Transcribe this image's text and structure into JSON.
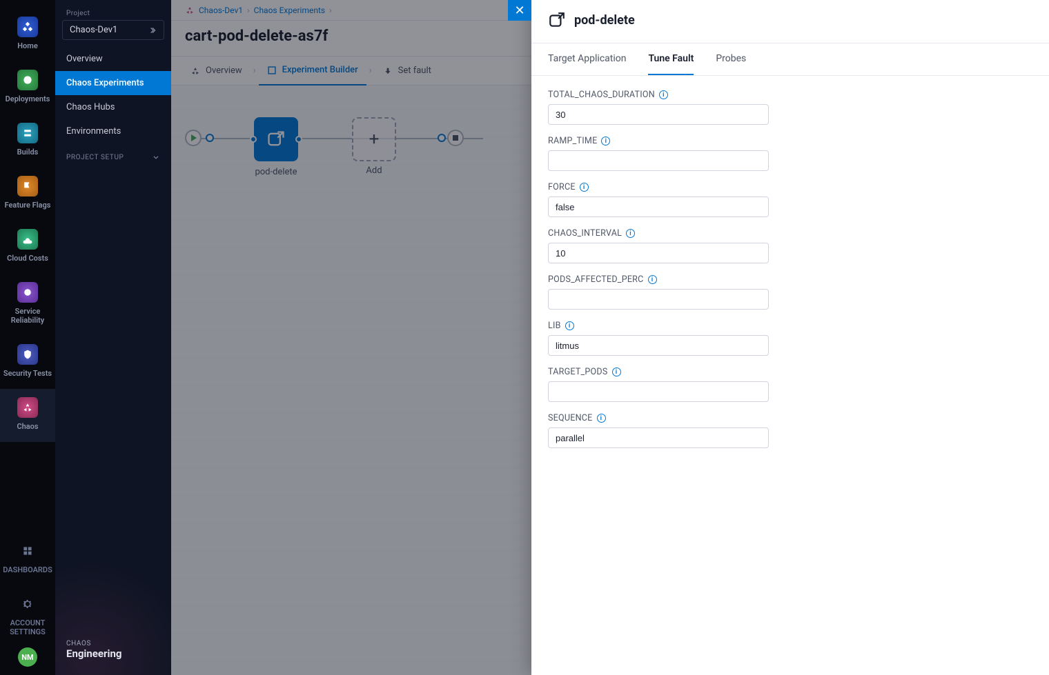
{
  "leftrail": {
    "items": [
      {
        "key": "home",
        "label": "Home"
      },
      {
        "key": "deployments",
        "label": "Deployments"
      },
      {
        "key": "builds",
        "label": "Builds"
      },
      {
        "key": "featureflags",
        "label": "Feature Flags"
      },
      {
        "key": "cloudcosts",
        "label": "Cloud Costs"
      },
      {
        "key": "sre",
        "label": "Service\nReliability"
      },
      {
        "key": "security",
        "label": "Security Tests"
      },
      {
        "key": "chaos",
        "label": "Chaos"
      }
    ],
    "bottom": [
      {
        "key": "dashboards",
        "label": "DASHBOARDS"
      },
      {
        "key": "account",
        "label": "ACCOUNT\nSETTINGS"
      }
    ],
    "avatar": "NM"
  },
  "sidebar": {
    "project_label": "Project",
    "project_value": "Chaos-Dev1",
    "items": [
      {
        "label": "Overview"
      },
      {
        "label": "Chaos Experiments",
        "active": true
      },
      {
        "label": "Chaos Hubs"
      },
      {
        "label": "Environments"
      }
    ],
    "section": "PROJECT SETUP",
    "module_badge": {
      "top": "CHAOS",
      "main": "Engineering"
    }
  },
  "breadcrumb": {
    "a": "Chaos-Dev1",
    "b": "Chaos Experiments"
  },
  "page_title": "cart-pod-delete-as7f",
  "steps": [
    {
      "label": "Overview"
    },
    {
      "label": "Experiment Builder",
      "active": true
    },
    {
      "label": "Set fault"
    }
  ],
  "workflow": {
    "node_label": "pod-delete",
    "add_label": "Add"
  },
  "flyout": {
    "title": "pod-delete",
    "tabs": [
      {
        "label": "Target Application"
      },
      {
        "label": "Tune Fault",
        "active": true
      },
      {
        "label": "Probes"
      }
    ],
    "fields": [
      {
        "key": "TOTAL_CHAOS_DURATION",
        "value": "30"
      },
      {
        "key": "RAMP_TIME",
        "value": ""
      },
      {
        "key": "FORCE",
        "value": "false"
      },
      {
        "key": "CHAOS_INTERVAL",
        "value": "10"
      },
      {
        "key": "PODS_AFFECTED_PERC",
        "value": ""
      },
      {
        "key": "LIB",
        "value": "litmus"
      },
      {
        "key": "TARGET_PODS",
        "value": ""
      },
      {
        "key": "SEQUENCE",
        "value": "parallel"
      }
    ]
  }
}
